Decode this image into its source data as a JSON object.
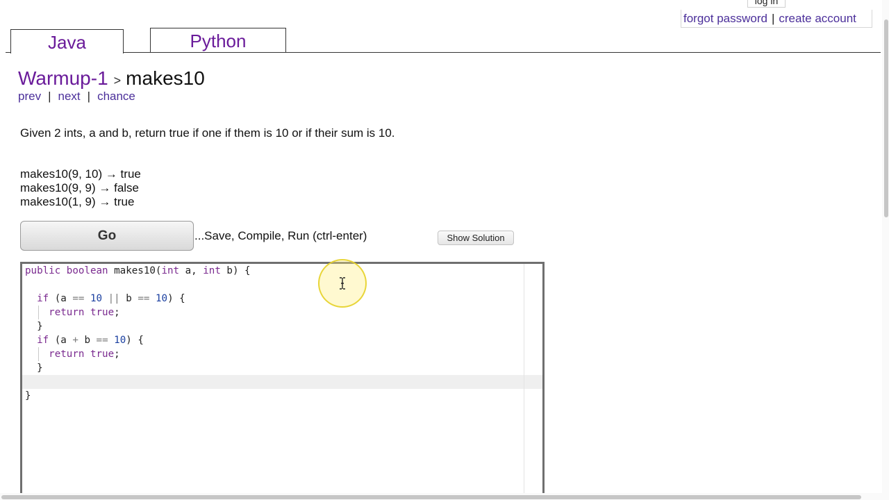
{
  "header": {
    "login_label": "log in",
    "forgot_password": "forgot password",
    "separator": "|",
    "create_account": "create account"
  },
  "tabs": [
    {
      "label": "Java",
      "active": true
    },
    {
      "label": "Python",
      "active": false
    }
  ],
  "breadcrumb": {
    "set": "Warmup-1",
    "arrow": ">",
    "problem": "makes10"
  },
  "nav": {
    "prev": "prev",
    "next": "next",
    "chance": "chance",
    "separator": "|"
  },
  "problem": {
    "description": "Given 2 ints, a and b, return true if one if them is 10 or if their sum is 10.",
    "examples": [
      "makes10(9, 10) → true",
      "makes10(9, 9) → false",
      "makes10(1, 9) → true"
    ]
  },
  "actions": {
    "go_label": "Go",
    "go_caption": "...Save, Compile, Run (ctrl-enter)",
    "show_solution_label": "Show Solution"
  },
  "editor": {
    "lines": [
      "public boolean makes10(int a, int b) {",
      "",
      "  if (a == 10 || b == 10) {",
      "    return true;",
      "  }",
      "  if (a + b == 10) {",
      "    return true;",
      "  }",
      "",
      "}"
    ],
    "active_line_index": 8
  },
  "colors": {
    "tab_text": "#6a1b9a",
    "link": "#4b2f9a",
    "keyword": "#7a2a8f",
    "number": "#1a3fa0",
    "cursor_highlight": "#f5e24a"
  }
}
